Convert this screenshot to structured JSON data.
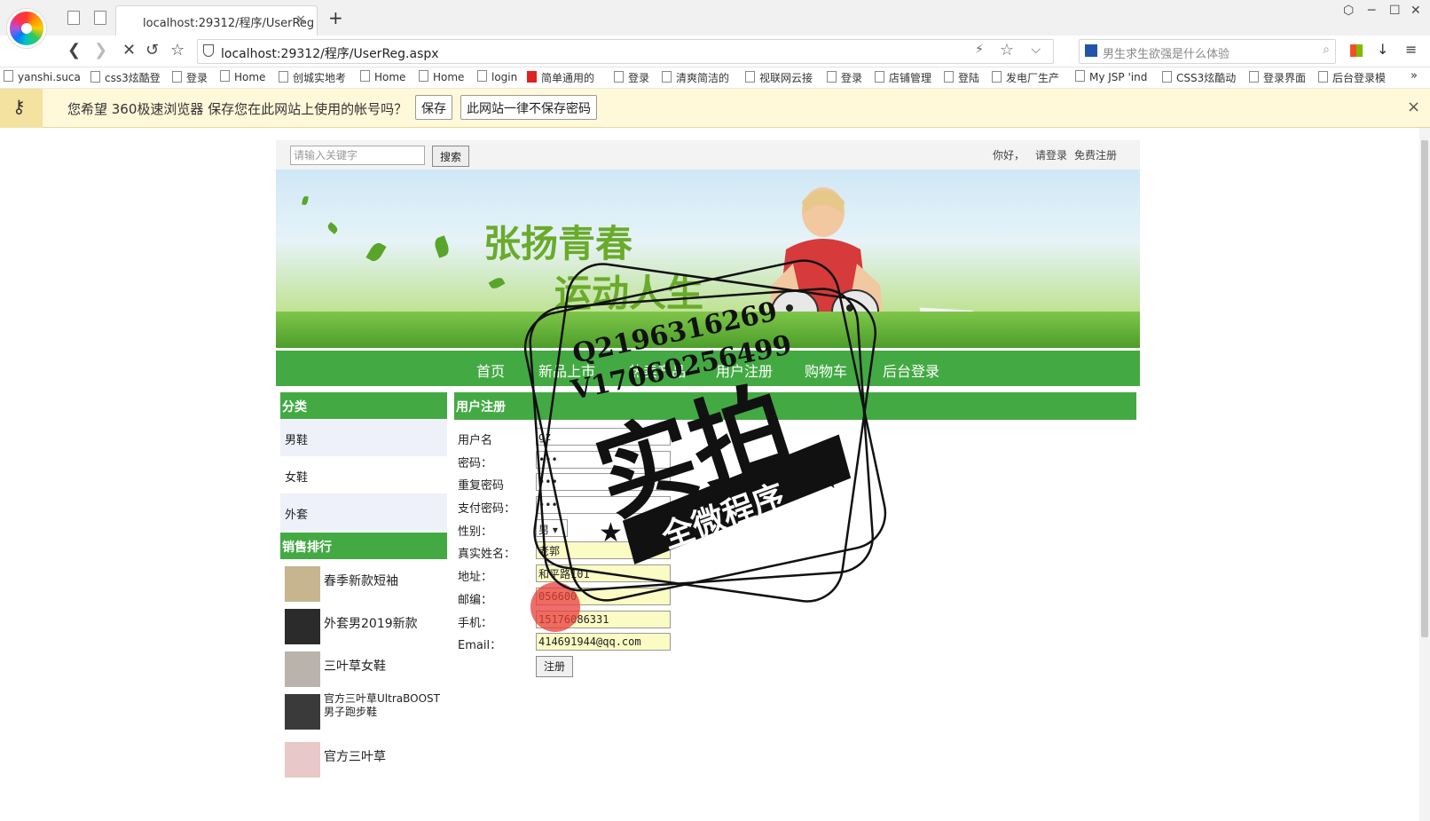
{
  "browser": {
    "tab_title": "localhost:29312/程序/UserReg",
    "tab_close": "×",
    "new_tab": "+",
    "url": "localhost:29312/程序/UserReg.aspx",
    "search_placeholder": "男生求生欲强是什么体验",
    "window_controls": [
      "⬡",
      "─",
      "☐",
      "✕"
    ],
    "bookmarks": [
      "yanshi.suca",
      "css3炫酷登",
      "登录",
      "Home",
      "创城实地考",
      "Home",
      "Home",
      "login",
      "简单通用的",
      "登录",
      "清爽简洁的",
      "视联网云接",
      "登录",
      "店铺管理",
      "登陆",
      "发电厂生产",
      "My JSP 'ind",
      "CSS3炫酷动",
      "登录界面",
      "后台登录模"
    ],
    "bookmarks_more": "»",
    "password_prompt": {
      "message": "您希望 360极速浏览器 保存您在此网站上使用的帐号吗？",
      "save_button": "保存",
      "never_button": "此网站一律不保存密码",
      "close": "×"
    }
  },
  "site": {
    "search_placeholder": "请输入关键字",
    "search_button": "搜索",
    "greeting": "你好，",
    "login_link": "请登录",
    "register_link": "免费注册",
    "banner": {
      "slogan_line1": "张扬青春",
      "slogan_line2": "运动人生"
    },
    "nav": [
      "首页",
      "新品上市",
      "热卖产品",
      "用户注册",
      "购物车",
      "后台登录"
    ],
    "sidebar": {
      "category_title": "分类",
      "categories": [
        "男鞋",
        "女鞋",
        "外套"
      ],
      "ranking_title": "销售排行",
      "ranking": [
        "春季新款短袖",
        "外套男2019新款",
        "三叶草女鞋",
        "官方三叶草UltraBOOST男子跑步鞋",
        "官方三叶草"
      ]
    },
    "form": {
      "title": "用户注册",
      "fields": [
        {
          "label": "用户名",
          "value": "gz"
        },
        {
          "label": "密码：",
          "value": "•••"
        },
        {
          "label": "重复密码",
          "value": "•••"
        },
        {
          "label": "支付密码：",
          "value": "•••"
        },
        {
          "label": "性别：",
          "value": "男"
        },
        {
          "label": "真实姓名：",
          "value": "老郭"
        },
        {
          "label": "地址：",
          "value": "和平路101"
        },
        {
          "label": "邮编：",
          "value": "056600"
        },
        {
          "label": "手机：",
          "value": "15176086331"
        },
        {
          "label": "Email：",
          "value": "414691944@qq.com"
        }
      ],
      "submit": "注册"
    }
  },
  "watermark": {
    "line1": "Q2196316269",
    "line2": "V17060256499",
    "big": "实拍",
    "ribbon": "全微程序"
  },
  "colors": {
    "site_green": "#43aa43",
    "banner_slogan": "#6aab2a",
    "prompt_bar": "#fff8d9"
  }
}
